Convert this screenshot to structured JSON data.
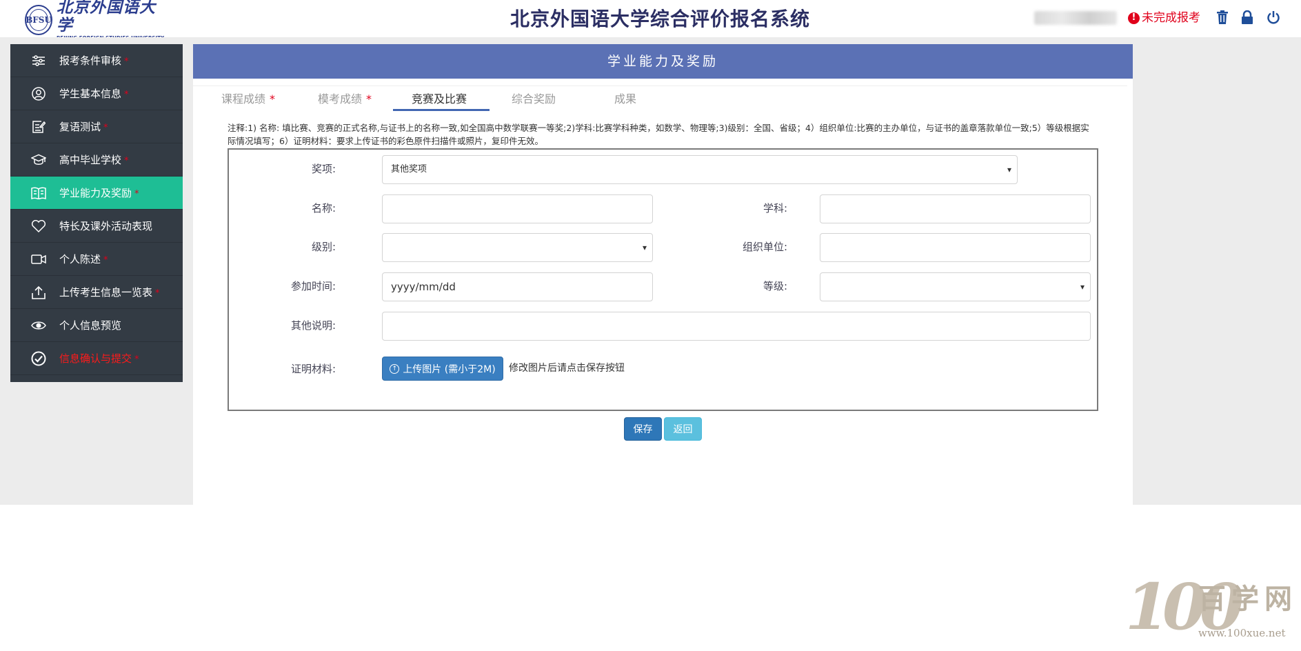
{
  "header": {
    "logo_cn": "北京外国语大学",
    "logo_en": "BEIJING FOREIGN STUDIES UNIVERSITY",
    "logo_seal": "BFSU",
    "system_title": "北京外国语大学综合评价报名系统",
    "status_icon": "!",
    "status_text": "未完成报考",
    "icons": [
      "trash-icon",
      "lock-icon",
      "power-icon"
    ]
  },
  "colors": {
    "sidebar_bg": "#333b44",
    "sidebar_active": "#1ebe95",
    "panel_header": "#5b71b5",
    "required_mark": "#e0001b",
    "save_button": "#2e77b8",
    "back_button": "#5bc0de"
  },
  "sidebar": {
    "items": [
      {
        "label": "报考条件审核",
        "req": "*",
        "icon": "sliders-icon"
      },
      {
        "label": "学生基本信息",
        "req": "*",
        "icon": "user-icon"
      },
      {
        "label": "复语测试",
        "req": "*",
        "icon": "edit-icon"
      },
      {
        "label": "高中毕业学校",
        "req": "*",
        "icon": "graduation-cap-icon"
      },
      {
        "label": "学业能力及奖励",
        "req": "*",
        "icon": "book-icon",
        "active": true
      },
      {
        "label": "特长及课外活动表现",
        "req": "",
        "icon": "heart-icon"
      },
      {
        "label": "个人陈述",
        "req": "*",
        "icon": "video-icon"
      },
      {
        "label": "上传考生信息一览表",
        "req": "*",
        "icon": "upload-icon"
      },
      {
        "label": "个人信息预览",
        "req": "",
        "icon": "eye-icon"
      },
      {
        "label": "信息确认与提交",
        "req": "*",
        "icon": "check-circle-icon"
      }
    ]
  },
  "main": {
    "title": "学业能力及奖励",
    "tabs": [
      {
        "label": "课程成绩",
        "req": "*"
      },
      {
        "label": "模考成绩",
        "req": "*"
      },
      {
        "label": "竞赛及比赛",
        "req": ""
      },
      {
        "label": "综合奖励",
        "req": ""
      },
      {
        "label": "成果",
        "req": ""
      }
    ],
    "note": "注释:1) 名称: 填比赛、竞赛的正式名称,与证书上的名称一致,如全国高中数学联赛一等奖;2)学科:比赛学科种类，如数学、物理等;3)级别：全国、省级；4）组织单位:比赛的主办单位，与证书的盖章落款单位一致;5）等级根据实际情况填写；6）证明材料：要求上传证书的彩色原件扫描件或照片，复印件无效。",
    "form": {
      "award_label": "奖项:",
      "award_value": "其他奖项",
      "name_label": "名称:",
      "name_value": "",
      "subject_label": "学科:",
      "subject_value": "",
      "level_label": "级别:",
      "level_value": "",
      "org_label": "组织单位:",
      "org_value": "",
      "date_label": "参加时间:",
      "date_placeholder": "yyyy/mm/dd",
      "grade_label": "等级:",
      "grade_value": "",
      "other_label": "其他说明:",
      "other_value": "",
      "proof_label": "证明材料:",
      "upload_label": "上传图片 (需小于2M)",
      "upload_hint": "修改图片后请点击保存按钮"
    },
    "buttons": {
      "save": "保存",
      "back": "返回"
    }
  },
  "watermark": {
    "number": "100",
    "text": "百学网",
    "url": "www.100xue.net"
  }
}
